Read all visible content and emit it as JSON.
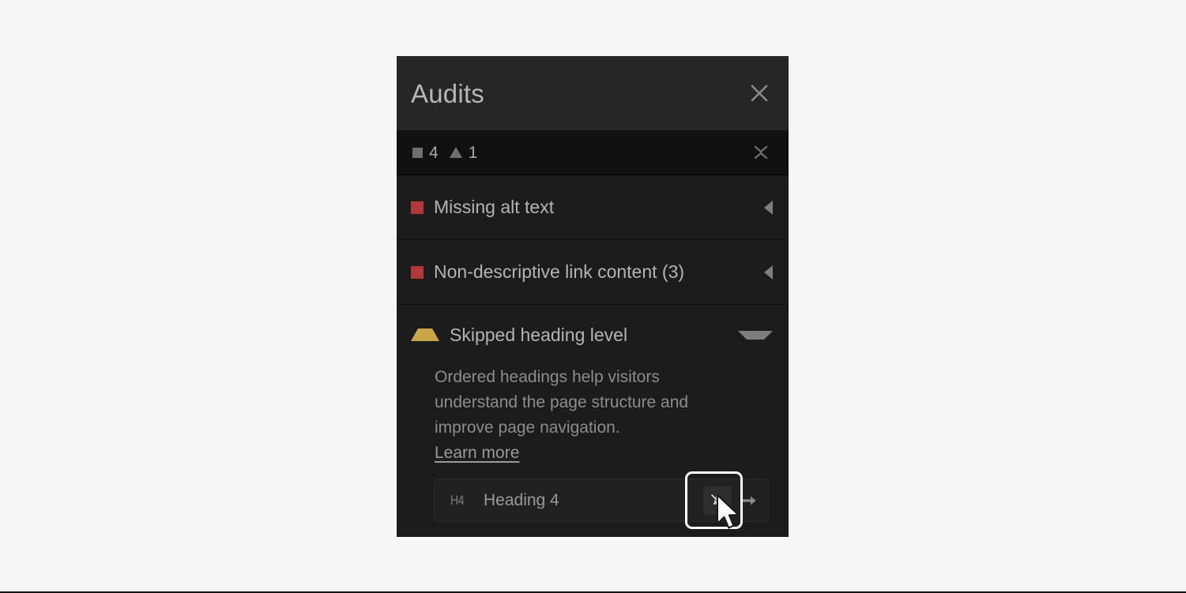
{
  "panel": {
    "title": "Audits",
    "close_icon": "close-icon"
  },
  "summary": {
    "error_count": "4",
    "warning_count": "1",
    "error_marker_icon": "square-marker-icon",
    "warning_marker_icon": "triangle-marker-icon",
    "collapse_all_icon": "collapse-all-icon"
  },
  "audits": [
    {
      "severity": "error",
      "label": "Missing alt text",
      "expanded": false,
      "disclosure_icon": "triangle-left-icon"
    },
    {
      "severity": "error",
      "label": "Non-descriptive link content (3)",
      "expanded": false,
      "disclosure_icon": "triangle-left-icon"
    },
    {
      "severity": "warning",
      "label": "Skipped heading level",
      "expanded": true,
      "disclosure_icon": "triangle-down-icon",
      "description": "Ordered headings help visitors understand the page structure and improve page navigation.",
      "learn_more_label": "Learn more",
      "results": [
        {
          "tag": "H4",
          "name": "Heading 4",
          "mute_icon": "bell-slash-icon",
          "goto_icon": "arrow-right-icon"
        }
      ]
    }
  ],
  "colors": {
    "page_background": "#f5f6f8",
    "panel_background": "#1c1c1c",
    "header_background": "#262626",
    "summary_background": "#111111",
    "error_marker": "#b03a3a",
    "warning_marker": "#c9a648",
    "text_primary": "#b4b4b4",
    "text_secondary": "#8d8d8d",
    "focus_ring": "#ffffff"
  }
}
